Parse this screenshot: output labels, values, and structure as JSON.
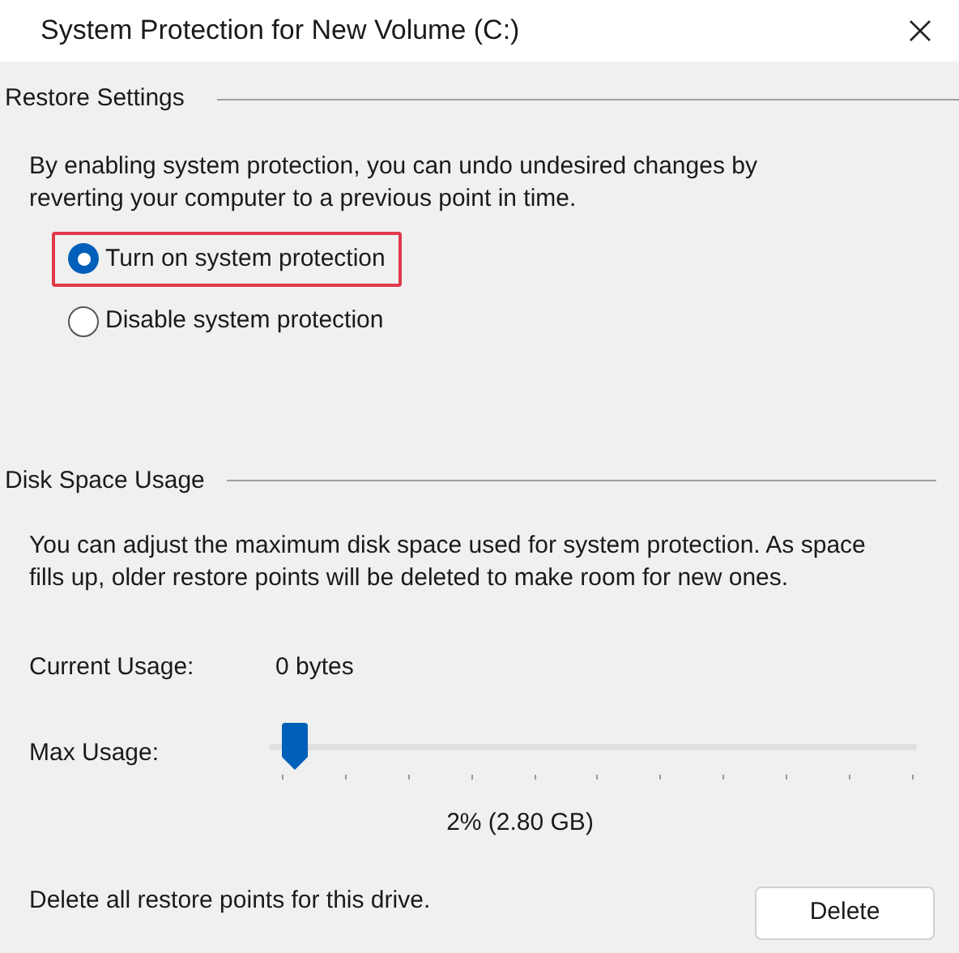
{
  "window": {
    "title": "System Protection for New Volume (C:)"
  },
  "restore_settings": {
    "heading": "Restore Settings",
    "description": "By enabling system protection, you can undo undesired changes by reverting your computer to a previous point in time.",
    "options": [
      {
        "label": "Turn on system protection",
        "selected": true,
        "highlighted": true
      },
      {
        "label": "Disable system protection",
        "selected": false,
        "highlighted": false
      }
    ]
  },
  "disk_space_usage": {
    "heading": "Disk Space Usage",
    "description": "You can adjust the maximum disk space used for system protection. As space fills up, older restore points will be deleted to make room for new ones.",
    "current_usage": {
      "label": "Current Usage:",
      "value": "0 bytes"
    },
    "max_usage": {
      "label": "Max Usage:",
      "level": 0.02,
      "reading": "2% (2.80 GB)"
    },
    "delete_note": "Delete all restore points for this drive.",
    "delete_button": "Delete"
  }
}
